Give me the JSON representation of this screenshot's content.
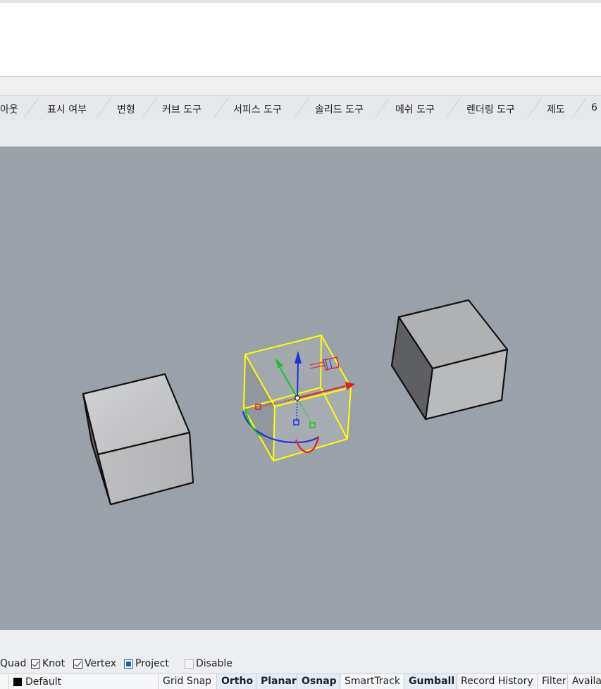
{
  "tabs": [
    "아웃",
    "표시 여부",
    "변형",
    "커브 도구",
    "서피스 도구",
    "솔리드 도구",
    "메쉬 도구",
    "렌더링 도구",
    "제도",
    "6"
  ],
  "osnap": [
    {
      "label": "Quad",
      "state": "partial"
    },
    {
      "label": "Knot",
      "state": "checked"
    },
    {
      "label": "Vertex",
      "state": "checked"
    },
    {
      "label": "Project",
      "state": "indeterminate"
    },
    {
      "label": "Disable",
      "state": "unchecked"
    }
  ],
  "status": {
    "layer": "Default",
    "layer_color": "#000000",
    "buttons": [
      {
        "label": "Grid Snap",
        "active": false
      },
      {
        "label": "Ortho",
        "active": true
      },
      {
        "label": "Planar",
        "active": true
      },
      {
        "label": "Osnap",
        "active": true
      },
      {
        "label": "SmartTrack",
        "active": false
      },
      {
        "label": "Gumball",
        "active": true
      },
      {
        "label": "Record History",
        "active": false
      },
      {
        "label": "Filter",
        "active": false
      },
      {
        "label": "Availa",
        "active": false
      }
    ]
  },
  "colors": {
    "viewport_bg": "#9aa1a9",
    "selection": "#ffff00",
    "gumball_x": "#e02020",
    "gumball_y": "#20c020",
    "gumball_z": "#2030e0"
  }
}
